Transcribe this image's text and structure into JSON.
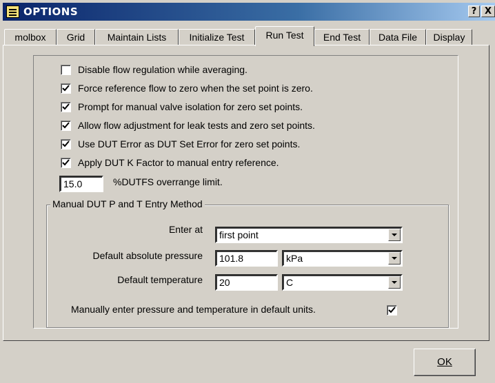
{
  "window": {
    "title": "OPTIONS",
    "help_label": "?",
    "close_label": "X"
  },
  "tabs": [
    {
      "label": "molbox",
      "active": false
    },
    {
      "label": "Grid",
      "active": false
    },
    {
      "label": "Maintain Lists",
      "active": false
    },
    {
      "label": "Initialize Test",
      "active": false
    },
    {
      "label": "Run Test",
      "active": true
    },
    {
      "label": "End Test",
      "active": false
    },
    {
      "label": "Data File",
      "active": false
    },
    {
      "label": "Display",
      "active": false
    }
  ],
  "options": [
    {
      "label": "Disable flow regulation while averaging.",
      "checked": false
    },
    {
      "label": "Force reference flow to zero when the set point is zero.",
      "checked": true
    },
    {
      "label": "Prompt for manual valve isolation for zero set points.",
      "checked": true
    },
    {
      "label": "Allow flow adjustment for leak tests and zero set points.",
      "checked": true
    },
    {
      "label": "Use DUT Error as DUT Set Error for zero set points.",
      "checked": true
    },
    {
      "label": "Apply DUT K Factor to manual entry reference.",
      "checked": true
    }
  ],
  "overrange": {
    "value": "15.0",
    "label": "%DUTFS overrange limit."
  },
  "manual_entry": {
    "group_title": "Manual DUT P and T Entry Method",
    "enter_at_label": "Enter at",
    "enter_at_value": "first point",
    "pressure_label": "Default absolute pressure",
    "pressure_value": "101.8",
    "pressure_unit": "kPa",
    "temperature_label": "Default temperature",
    "temperature_value": "20",
    "temperature_unit": "C",
    "default_units_label": "Manually enter pressure and temperature in default units.",
    "default_units_checked": true
  },
  "buttons": {
    "ok_label": "OK"
  }
}
